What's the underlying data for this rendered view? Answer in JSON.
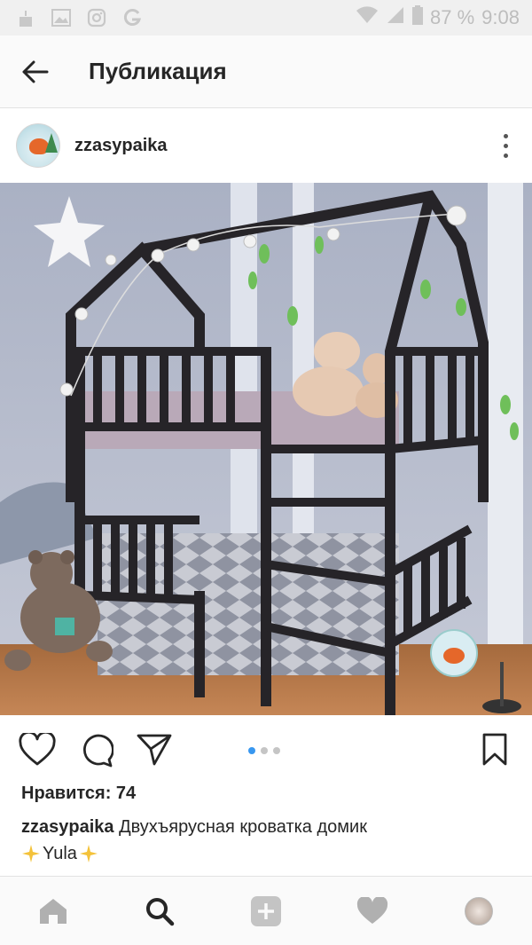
{
  "status_bar": {
    "battery": "87 %",
    "time": "9:08",
    "icons": [
      "cake-icon",
      "image-icon",
      "instagram-icon",
      "g-icon",
      "wifi-icon",
      "signal-icon",
      "battery-icon"
    ]
  },
  "header": {
    "title": "Публикация",
    "back_icon": "arrow-left-icon"
  },
  "post": {
    "username": "zzasypaika",
    "likes_text": "Нравится: 74",
    "caption_user": "zzasypaika",
    "caption_text": "Двухъярусная кроватка домик",
    "caption_line2": "Yula",
    "carousel": {
      "count": 3,
      "active": 0
    }
  },
  "colors": {
    "accent": "#3897f0",
    "text": "#262626",
    "icons": "#262626",
    "nav_icons": "#b0b0b0"
  },
  "bottom_nav": [
    "home-icon",
    "search-icon",
    "add-icon",
    "heart-icon",
    "profile-avatar"
  ]
}
